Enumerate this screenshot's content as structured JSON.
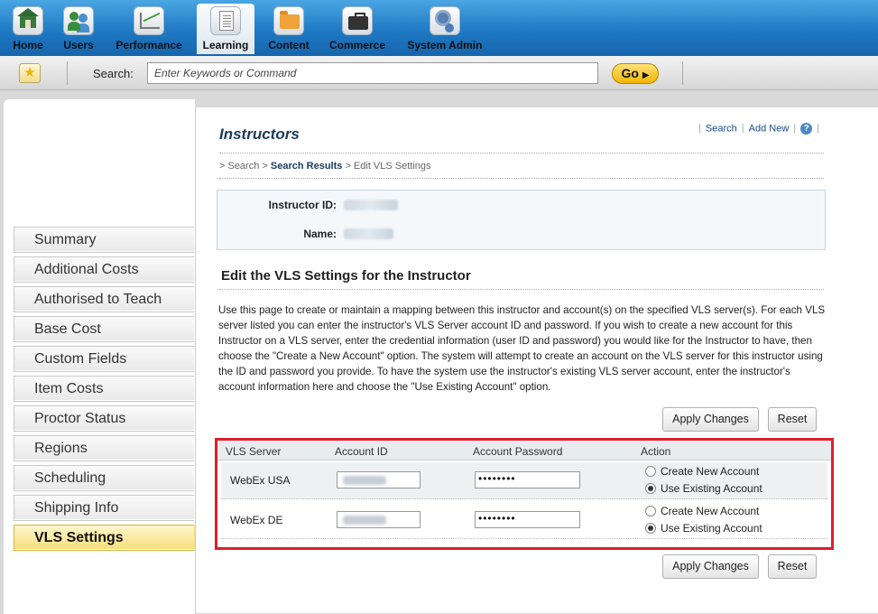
{
  "topnav": {
    "items": [
      {
        "label": "Home",
        "icon": "house-icon"
      },
      {
        "label": "Users",
        "icon": "users-icon"
      },
      {
        "label": "Performance",
        "icon": "chart-icon"
      },
      {
        "label": "Learning",
        "icon": "document-icon",
        "active": true
      },
      {
        "label": "Content",
        "icon": "folder-icon"
      },
      {
        "label": "Commerce",
        "icon": "briefcase-icon"
      },
      {
        "label": "System Admin",
        "icon": "gear-icon"
      }
    ]
  },
  "searchbar": {
    "label": "Search:",
    "placeholder": "Enter Keywords or Command",
    "go_label": "Go",
    "favorites_icon": "star-icon"
  },
  "sidebar": {
    "items": [
      {
        "label": "Summary"
      },
      {
        "label": "Additional Costs"
      },
      {
        "label": "Authorised to Teach"
      },
      {
        "label": "Base Cost"
      },
      {
        "label": "Custom Fields"
      },
      {
        "label": "Item Costs"
      },
      {
        "label": "Proctor Status"
      },
      {
        "label": "Regions"
      },
      {
        "label": "Scheduling"
      },
      {
        "label": "Shipping Info"
      },
      {
        "label": "VLS Settings",
        "active": true
      }
    ]
  },
  "main": {
    "title": "Instructors",
    "links": {
      "search": "Search",
      "add_new": "Add New",
      "help": "?"
    },
    "breadcrumb": {
      "sep1": "> Search >",
      "current_link": "Search Results",
      "tail": "> Edit VLS Settings"
    },
    "info": {
      "instructor_id_label": "Instructor ID:",
      "name_label": "Name:"
    },
    "section_title": "Edit the VLS Settings for the Instructor",
    "description": "Use this page to create or maintain a mapping between this instructor and account(s) on the specified VLS server(s). For each VLS server listed you can enter the instructor's VLS Server account ID and password. If you wish to create a new account for this Instructor on a VLS server, enter the credential information (user ID and password) you would like for the Instructor to have, then choose the \"Create a New Account\" option. The system will attempt to create an account on the VLS server for this instructor using the ID and password you provide. To have the system use the instructor's existing VLS server account, enter the instructor's account information here and choose the \"Use Existing Account\" option.",
    "buttons": {
      "apply": "Apply Changes",
      "reset": "Reset"
    },
    "vls_table": {
      "headers": {
        "server": "VLS Server",
        "account_id": "Account ID",
        "password": "Account Password",
        "action": "Action"
      },
      "rows": [
        {
          "server": "WebEx USA",
          "password": "••••••••",
          "option_create": "Create New Account",
          "option_existing": "Use Existing Account",
          "selected": "existing"
        },
        {
          "server": "WebEx DE",
          "password": "••••••••",
          "option_create": "Create New Account",
          "option_existing": "Use Existing Account",
          "selected": "existing"
        }
      ]
    }
  }
}
